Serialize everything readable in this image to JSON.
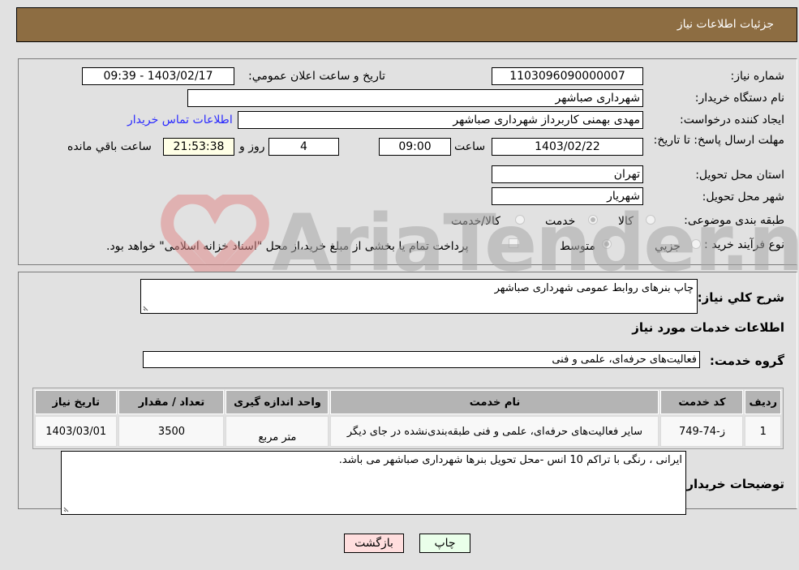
{
  "header": {
    "title": "جزئیات اطلاعات نیاز"
  },
  "form": {
    "need_number": {
      "label": "شماره نیاز:",
      "value": "1103096090000007"
    },
    "announce_datetime": {
      "label": "تاریخ و ساعت اعلان عمومي:",
      "value": "1403/02/17 - 09:39"
    },
    "buyer_org": {
      "label": "نام دستگاه خريدار:",
      "value": "شهرداری صباشهر"
    },
    "requester": {
      "label": "ایجاد کننده درخواست:",
      "value": "مهدی بهمنی کاربرداز شهرداری صباشهر"
    },
    "buyer_contact_link": "اطلاعات تماس خريدار",
    "deadline": {
      "label": "مهلت ارسال پاسخ: تا تاریخ:",
      "date": "1403/02/22",
      "time_label": "ساعت",
      "time": "09:00",
      "days": "4",
      "days_label": "روز و",
      "remaining": "21:53:38",
      "remaining_label": "ساعت باقي مانده"
    },
    "province": {
      "label": "استان محل تحویل:",
      "value": "تهران"
    },
    "city": {
      "label": "شهر محل تحویل:",
      "value": "شهریار"
    },
    "category": {
      "label": "طبقه بندی موضوعی:",
      "options": [
        "کالا",
        "خدمت",
        "کالا/خدمت"
      ],
      "selected": "خدمت"
    },
    "process_type": {
      "label": "نوع فرآیند خرید :",
      "options": [
        "جزيي",
        "متوسط"
      ],
      "selected": "متوسط",
      "treasury_note": "پرداخت تمام یا بخشی از مبلغ خرید،از محل \"اسناد خزانه اسلامی\" خواهد بود.",
      "treasury_checked": false
    }
  },
  "details": {
    "summary_label": "شرح کلي نیاز:",
    "summary_value": "چاپ بنرهای روابط عمومی شهرداری صباشهر",
    "services_heading": "اطلاعات خدمات مورد نیاز",
    "service_group_label": "گروه خدمت:",
    "service_group_value": "فعالیت‌های حرفه‌ای، علمی و فنی",
    "table": {
      "headers": [
        "ردیف",
        "کد خدمت",
        "نام خدمت",
        "واحد اندازه گیری",
        "تعداد / مقدار",
        "تاریخ نیاز"
      ],
      "rows": [
        [
          "1",
          "ز-74-749",
          "سایر فعالیت‌های حرفه‌ای، علمی و فنی طبقه‌بندی‌نشده در جای دیگر",
          "متر مربع",
          "3500",
          "1403/03/01"
        ]
      ]
    },
    "buyer_notes_label": "توضیحات خریدار:",
    "buyer_notes_value": "ایرانی ، رنگی با تراکم 10 انس -محل تحویل بنرها شهرداری صباشهر می باشد."
  },
  "buttons": {
    "print": "چاپ",
    "back": "بازگشت"
  },
  "watermark": {
    "text": "AriaTender.neT"
  },
  "colors": {
    "header_bg": "#8d6d42",
    "link": "#2a2aff",
    "print_bg": "#eaffea",
    "back_bg": "#ffdede",
    "remaining_bg": "#ffffe6"
  }
}
